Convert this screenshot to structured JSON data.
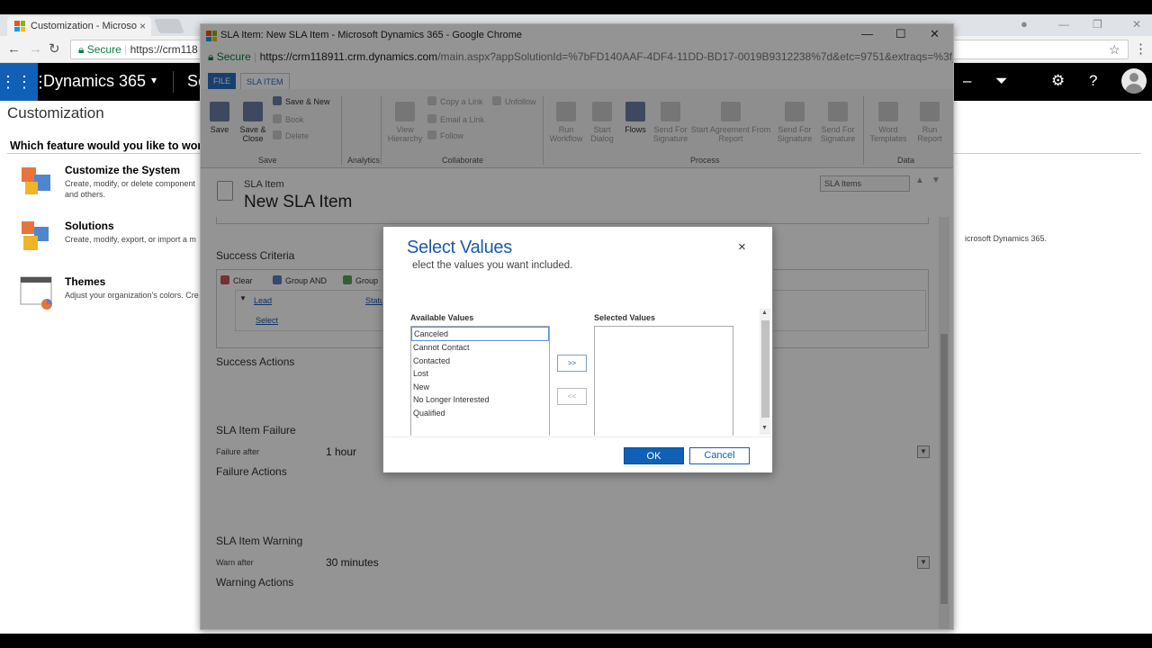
{
  "bg_browser": {
    "tab_title": "Customization - Microso",
    "tab_close": "×",
    "address_secure": "Secure",
    "address_url": "https://crm118",
    "min_glyph": "—",
    "max_glyph": "❐",
    "close_glyph": "✕"
  },
  "d365": {
    "app_name": "Dynamics 365",
    "area_initial": "Se",
    "page_title": "Customization",
    "question": "Which feature would you like to work",
    "features": [
      {
        "title": "Customize the System",
        "desc": "Create, modify, or delete component and others."
      },
      {
        "title": "Solutions",
        "desc": "Create, modify, export, or import a m"
      },
      {
        "title": "Themes",
        "desc": "Adjust your organization's colors. Cre"
      }
    ],
    "right_text": "icrosoft Dynamics 365."
  },
  "popup": {
    "title": "SLA Item: New SLA Item - Microsoft Dynamics 365 - Google Chrome",
    "secure": "Secure",
    "url_host": "https://crm118911.crm.dynamics.com",
    "url_path": "/main.aspx?appSolutionId=%7bFD140AAF-4DF4-11DD-BD17-0019B9312238%7d&etc=9751&extraqs=%3f_...",
    "ribbon_tabs": [
      "FILE",
      "SLA ITEM"
    ],
    "ribbon": {
      "save": "Save",
      "save_close": "Save & Close",
      "save_new": "Save & New",
      "book": "Book",
      "delete": "Delete",
      "copy_link": "Copy a Link",
      "email_link": "Email a Link",
      "follow": "Follow",
      "unfollow": "Unfollow",
      "view_hierarchy": "View Hierarchy",
      "run_workflow": "Run Workflow",
      "start_dialog": "Start Dialog",
      "flows": "Flows",
      "send_sig1": "Send For Signature",
      "start_agreement": "Start Agreement From Report",
      "send_sig2": "Send For Signature",
      "send_sig3": "Send For Signature",
      "word_templates": "Word Templates",
      "run_report": "Run Report",
      "groups": {
        "save": "Save",
        "analytics": "Analytics",
        "collaborate": "Collaborate",
        "process": "Process",
        "data": "Data"
      }
    },
    "entity_name": "SLA Item",
    "record_title": "New SLA Item",
    "form_selector": "SLA Items",
    "sections": {
      "success_criteria": "Success Criteria",
      "success_actions": "Success Actions",
      "failure": "SLA Item Failure",
      "failure_actions": "Failure Actions",
      "warning": "SLA Item Warning",
      "warning_actions": "Warning Actions"
    },
    "criteria_toolbar": {
      "clear": "Clear",
      "group_and": "Group AND",
      "group_or": "Group"
    },
    "criteria_row": {
      "entity": "Lead",
      "field": "Statu",
      "select": "Select"
    },
    "failure_after_label": "Failure after",
    "failure_after_value": "1 hour",
    "warn_after_label": "Warn after",
    "warn_after_value": "30 minutes"
  },
  "dialog": {
    "title": "Select Values",
    "description": "elect the values you want included.",
    "close": "×",
    "available_label": "Available Values",
    "selected_label": "Selected Values",
    "available_values": [
      "Canceled",
      "Cannot Contact",
      "Contacted",
      "Lost",
      "New",
      "No Longer Interested",
      "Qualified"
    ],
    "selected_values": [],
    "add_button": ">>",
    "remove_button": "<<",
    "ok": "OK",
    "cancel": "Cancel"
  }
}
